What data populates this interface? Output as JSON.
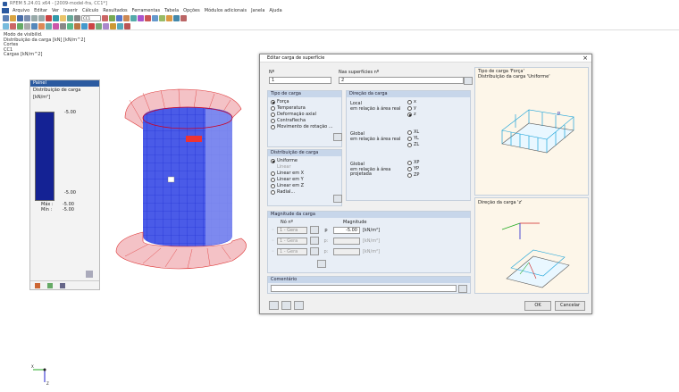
{
  "window_title": "RFEM 5.24.01 x64 - [2009-model-fra, CC1*]",
  "menu": [
    "Arquivo",
    "Editar",
    "Ver",
    "Inserir",
    "Cálculo",
    "Resultados",
    "Ferramentas",
    "Tabela",
    "Opções",
    "Módulos adicionais",
    "Janela",
    "Ajuda"
  ],
  "toolbar_combo": "CC1",
  "info": [
    "Modo de visibilid.",
    "Distribuição da carga [kN] [kN/m^2]",
    "Cortes",
    "CC1",
    "Cargas [kN/m^2]"
  ],
  "panel": {
    "title": "Painel",
    "legend_label": "Distribuição de carga",
    "unit": "[kN/m²]",
    "top_value": "-5.00",
    "bottom_value": "-5.00",
    "max_label": "Máx :",
    "max_value": "-5.00",
    "min_label": "Mín :",
    "min_value": "-5.00"
  },
  "axes": {
    "x": "X",
    "z": "Z"
  },
  "dialog": {
    "title": "Editar carga de superfície",
    "close": "×",
    "no_label": "Nº",
    "no_value": "1",
    "surfaces_label": "Nas superfícies nº",
    "surfaces_value": "2",
    "load_type": {
      "header": "Tipo de carga",
      "options": [
        "Força",
        "Temperatura",
        "Deformação axial",
        "Contraflecha",
        "Movimento de rotação ..."
      ]
    },
    "load_dir": {
      "header": "Direção da carga",
      "local_label": "Local\nem relação à área real",
      "local_opts": [
        "x",
        "y",
        "z"
      ],
      "global_label": "Global\nem relação à área real",
      "global_opts": [
        "XL",
        "YL",
        "ZL"
      ],
      "proj_label": "Global\nem relação à área\nprojetada",
      "proj_opts": [
        "XP",
        "YP",
        "ZP"
      ]
    },
    "load_dist": {
      "header": "Distribuição de carga",
      "options": [
        "Uniforme",
        "Linear",
        "Linear em X",
        "Linear em Y",
        "Linear em Z",
        "Radial..."
      ]
    },
    "magnitude": {
      "header": "Magnitude da carga",
      "node_col": "Nó nº",
      "mag_col": "Magnitude",
      "rows": [
        {
          "node": "1 - Gera",
          "sym": "p",
          "value": "-5.00",
          "unit": "[kN/m²]"
        },
        {
          "node": "1 - Gera",
          "sym": "p:",
          "value": "",
          "unit": "[kN/m²]"
        },
        {
          "node": "1 - Gera",
          "sym": "p:",
          "value": "",
          "unit": "[kN/m²]"
        }
      ]
    },
    "comment_label": "Comentário",
    "preview1": "Tipo de carga 'Força'\nDistribuição da carga 'Uniforme'",
    "preview1_p": "p",
    "preview2": "Direção da carga 'z'",
    "ok": "OK",
    "cancel": "Cancelar"
  }
}
